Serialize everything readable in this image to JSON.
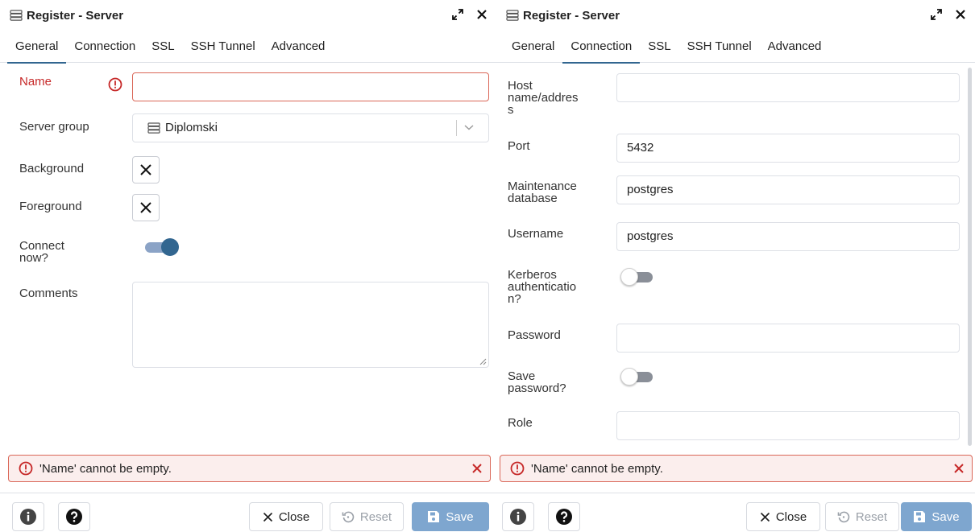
{
  "left": {
    "title": "Register - Server",
    "tabs": [
      "General",
      "Connection",
      "SSL",
      "SSH Tunnel",
      "Advanced"
    ],
    "active_tab": "General",
    "fields": {
      "name_label": "Name",
      "name_value": "",
      "server_group_label": "Server group",
      "server_group_value": "Diplomski",
      "background_label": "Background",
      "foreground_label": "Foreground",
      "connect_now_label_1": "Connect",
      "connect_now_label_2": "now?",
      "connect_now": true,
      "comments_label": "Comments",
      "comments_value": ""
    },
    "error_message": "'Name' cannot be empty.",
    "footer": {
      "close": "Close",
      "reset": "Reset",
      "save": "Save"
    }
  },
  "right": {
    "title": "Register - Server",
    "tabs": [
      "General",
      "Connection",
      "SSL",
      "SSH Tunnel",
      "Advanced"
    ],
    "active_tab": "Connection",
    "fields": {
      "host_label_1": "Host",
      "host_label_2": "name/addres",
      "host_label_3": "s",
      "host_value": "",
      "port_label": "Port",
      "port_value": "5432",
      "maint_label_1": "Maintenance",
      "maint_label_2": "database",
      "maint_value": "postgres",
      "username_label": "Username",
      "username_value": "postgres",
      "kerberos_label_1": "Kerberos",
      "kerberos_label_2": "authenticatio",
      "kerberos_label_3": "n?",
      "kerberos": false,
      "password_label": "Password",
      "password_value": "",
      "save_pw_label_1": "Save",
      "save_pw_label_2": "password?",
      "save_password": false,
      "role_label": "Role",
      "role_value": ""
    },
    "error_message": "'Name' cannot be empty.",
    "footer": {
      "close": "Close",
      "reset": "Reset",
      "save": "Save"
    }
  },
  "colors": {
    "accent": "#326690",
    "error": "#da6758",
    "error_bg": "#fbeeed",
    "save_button": "#7ea6cf"
  },
  "icons": [
    "server-icon",
    "expand-icon",
    "close-icon",
    "error-circle-icon",
    "x-icon",
    "info-icon",
    "help-icon",
    "reset-icon",
    "save-icon",
    "chevron-down-icon"
  ]
}
